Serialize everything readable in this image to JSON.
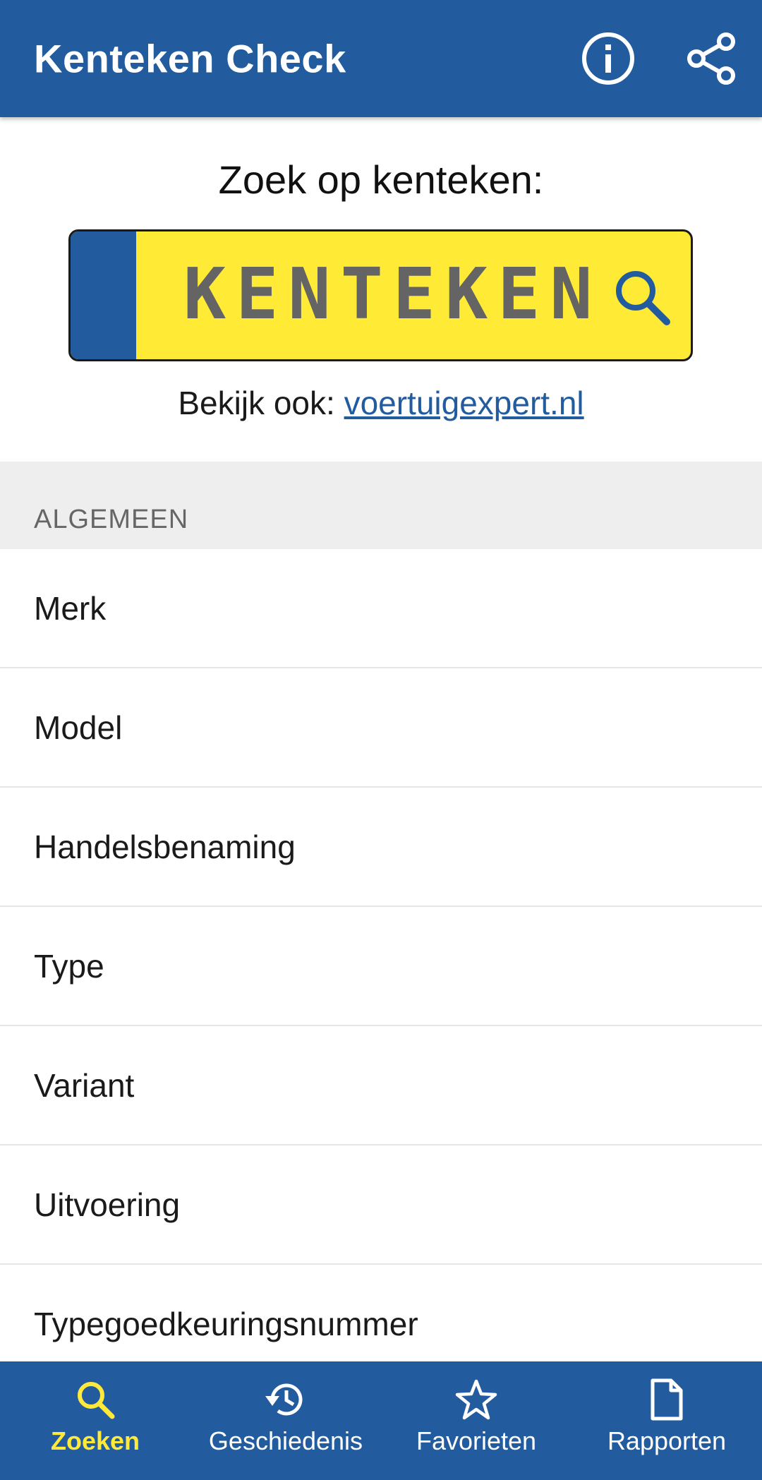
{
  "app": {
    "title": "Kenteken Check"
  },
  "search": {
    "heading": "Zoek op kenteken:",
    "plate_placeholder": "KENTEKEN",
    "also_prefix": "Bekijk ook: ",
    "also_link": "voertuigexpert.nl"
  },
  "section": {
    "title": "ALGEMEEN",
    "items": [
      {
        "label": "Merk"
      },
      {
        "label": "Model"
      },
      {
        "label": "Handelsbenaming"
      },
      {
        "label": "Type"
      },
      {
        "label": "Variant"
      },
      {
        "label": "Uitvoering"
      },
      {
        "label": "Typegoedkeuringsnummer"
      }
    ]
  },
  "nav": {
    "items": [
      {
        "label": "Zoeken",
        "icon": "search-icon",
        "active": true
      },
      {
        "label": "Geschiedenis",
        "icon": "history-icon",
        "active": false
      },
      {
        "label": "Favorieten",
        "icon": "star-icon",
        "active": false
      },
      {
        "label": "Rapporten",
        "icon": "document-icon",
        "active": false
      }
    ]
  },
  "colors": {
    "primary": "#225c9f",
    "plate_yellow": "#ffea35",
    "active_nav": "#ffe93b"
  }
}
